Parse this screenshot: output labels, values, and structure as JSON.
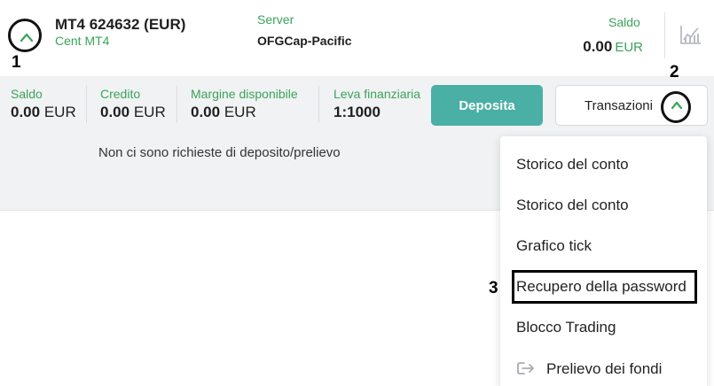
{
  "account": {
    "title": "MT4 624632 (EUR)",
    "type": "Cent MT4",
    "server_label": "Server",
    "server_name": "OFGCap-Pacific",
    "saldo_label": "Saldo",
    "saldo_value": "0.00",
    "saldo_currency": "EUR"
  },
  "stats": [
    {
      "label": "Saldo",
      "value": "0.00",
      "unit": "EUR"
    },
    {
      "label": "Credito",
      "value": "0.00",
      "unit": "EUR"
    },
    {
      "label": "Margine disponibile",
      "value": "0.00",
      "unit": "EUR"
    },
    {
      "label": "Leva finanziaria",
      "value": "1:1000",
      "unit": ""
    }
  ],
  "buttons": {
    "deposit": "Deposita",
    "transactions": "Transazioni"
  },
  "empty_message": "Non ci sono richieste di deposito/prelievo",
  "menu": [
    "Storico del conto",
    "Storico del conto",
    "Grafico tick",
    "Recupero della password",
    "Blocco Trading",
    "Prelievo dei fondi"
  ],
  "annotations": [
    "1",
    "2",
    "3"
  ],
  "colors": {
    "accent_green": "#3aa35a",
    "deposit_button": "#4aafa4",
    "panel_bg": "#f1f2f4"
  },
  "icons": [
    "chevron-up-icon",
    "chart-icon",
    "logout-icon"
  ]
}
